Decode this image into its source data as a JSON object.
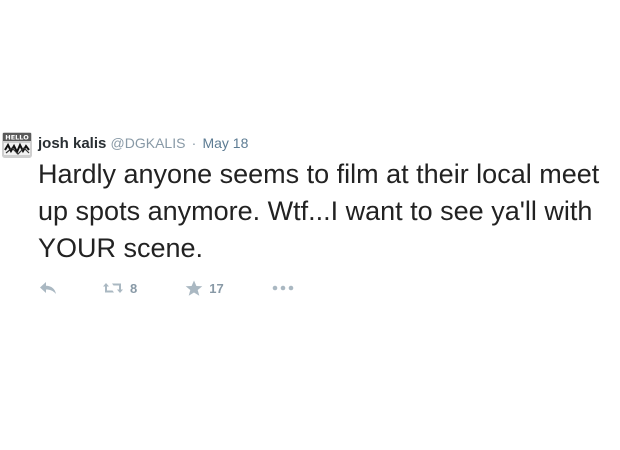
{
  "tweet": {
    "author_name": "josh kalis",
    "handle": "@DGKALIS",
    "separator": "·",
    "timestamp": "May 18",
    "text": "Hardly anyone seems to film at their local meet up spots anymore. Wtf...I want to see ya'll with YOUR scene.",
    "avatar": {
      "icon": "hello-sticker-avatar",
      "text": "HELLO"
    }
  },
  "actions": {
    "reply": {
      "icon": "reply-icon"
    },
    "retweet": {
      "icon": "retweet-icon",
      "count": "8"
    },
    "favorite": {
      "icon": "star-icon",
      "count": "17"
    },
    "more": {
      "icon": "more-icon"
    }
  },
  "colors": {
    "text": "#222222",
    "meta": "#8899a6",
    "icon": "#aab8c2",
    "timestamp_link": "#5d7c93"
  }
}
